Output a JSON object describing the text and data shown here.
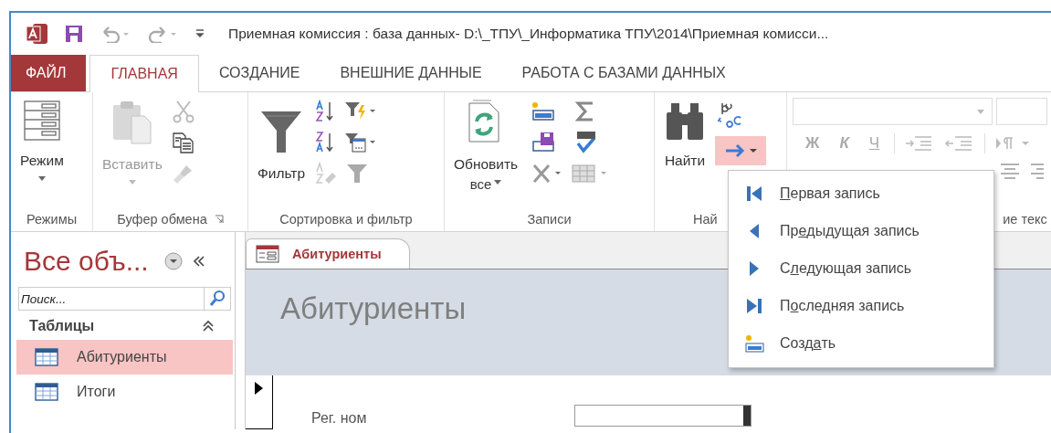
{
  "window": {
    "title": "Приемная комиссия : база данных- D:\\_ТПУ\\_Информатика ТПУ\\2014\\Приемная комисси..."
  },
  "tabs": [
    {
      "label": "ФАЙЛ",
      "kind": "file",
      "selected": false
    },
    {
      "label": "ГЛАВНАЯ",
      "kind": "tab",
      "selected": true
    },
    {
      "label": "СОЗДАНИЕ",
      "kind": "tab",
      "selected": false
    },
    {
      "label": "ВНЕШНИЕ ДАННЫЕ",
      "kind": "tab",
      "selected": false
    },
    {
      "label": "РАБОТА С БАЗАМИ ДАННЫХ",
      "kind": "tab",
      "selected": false
    }
  ],
  "ribbon": {
    "groups": [
      {
        "kind": "views",
        "label": "Режимы",
        "buttons": [
          {
            "label": "Режим",
            "disabled": false
          }
        ]
      },
      {
        "kind": "clipboard",
        "label": "Буфер обмена",
        "buttons": [
          {
            "label": "Вставить",
            "disabled": true
          }
        ]
      },
      {
        "kind": "sort",
        "label": "Сортировка и фильтр",
        "buttons": [
          {
            "label": "Фильтр",
            "disabled": false
          }
        ]
      },
      {
        "kind": "records",
        "label": "Записи",
        "buttons": [
          {
            "label": "Обновить",
            "label_2": "все",
            "disabled": false
          }
        ]
      },
      {
        "kind": "find",
        "label": "Най",
        "buttons": [
          {
            "label": "Найти",
            "disabled": false
          }
        ],
        "goto_pressed": true
      },
      {
        "kind": "format",
        "label": "ие текс",
        "buttons": [
          {
            "label": "Ж",
            "disabled": true
          },
          {
            "label": "К",
            "disabled": true
          },
          {
            "label": "Ч",
            "disabled": true
          }
        ]
      }
    ]
  },
  "goto_menu": {
    "items": [
      {
        "kind": "first",
        "key": "П",
        "post": "ервая запись"
      },
      {
        "kind": "prev",
        "pre": "Пр",
        "key": "е",
        "post": "дыдущая запись"
      },
      {
        "kind": "next",
        "pre": "С",
        "key": "л",
        "post": "едующая запись"
      },
      {
        "kind": "last",
        "pre": "П",
        "key": "о",
        "post": "следняя запись"
      },
      {
        "kind": "new",
        "pre": "Созд",
        "key": "а",
        "post": "ть"
      }
    ]
  },
  "navigation_pane": {
    "title": "Все объ...",
    "search": {
      "placeholder": "Поиск..."
    },
    "section": {
      "label": "Таблицы",
      "expanded": true
    },
    "items": [
      {
        "label": "Абитуриенты",
        "selected": true
      },
      {
        "label": "Итоги",
        "selected": false
      }
    ]
  },
  "document": {
    "tab": {
      "label": "Абитуриенты",
      "selected": true
    },
    "form_title": "Абитуриенты",
    "record_selector": {
      "current": true
    },
    "fields": [
      {
        "label": "Рег. ном"
      }
    ]
  }
}
